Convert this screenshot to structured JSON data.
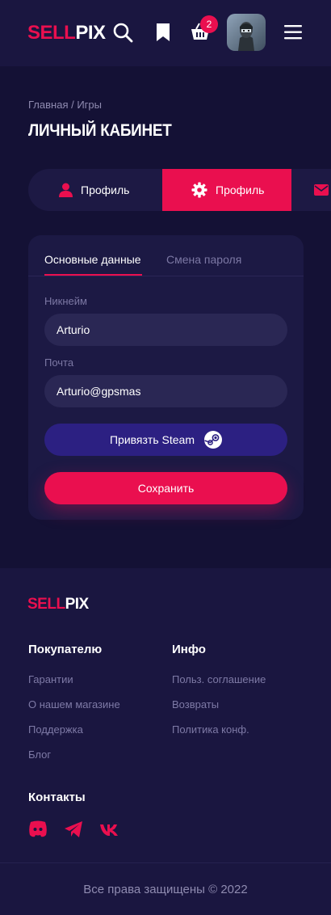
{
  "header": {
    "logo_part1": "SELL",
    "logo_part2": "PIX",
    "cart_count": "2",
    "icons": [
      "search-icon",
      "bookmark-icon",
      "cart-icon",
      "menu-icon"
    ]
  },
  "breadcrumb": "Главная / Игры",
  "page_title": "ЛИЧНЫЙ КАБИНЕТ",
  "tabs": [
    {
      "label": "Профиль",
      "icon": "user-icon",
      "active": false
    },
    {
      "label": "Профиль",
      "icon": "gear-icon",
      "active": true
    },
    {
      "label": "",
      "icon": "mail-icon",
      "active": false
    }
  ],
  "form": {
    "subtabs": [
      "Основные данные",
      "Смена пароля"
    ],
    "nickname_label": "Никнейм",
    "nickname_value": "Arturio",
    "email_label": "Почта",
    "email_value": "Arturio@gpsmas",
    "steam_button": "Привязть Steam",
    "save_button": "Сохранить"
  },
  "footer": {
    "logo_part1": "SELL",
    "logo_part2": "PIX",
    "buyer_title": "Покупателю",
    "buyer_links": [
      "Гарантии",
      "О нашем магазине",
      "Поддержка",
      "Блог"
    ],
    "info_title": "Инфо",
    "info_links": [
      "Польз. соглашение",
      "Возвраты",
      "Политика конф."
    ],
    "contacts_title": "Контакты",
    "socials": [
      "discord-icon",
      "telegram-icon",
      "vk-icon"
    ],
    "copyright": "Все права защищены © 2022"
  },
  "colors": {
    "accent": "#ea0f4f",
    "background": "#141135",
    "panel": "#1c1944",
    "steam_button": "#2c2082"
  }
}
